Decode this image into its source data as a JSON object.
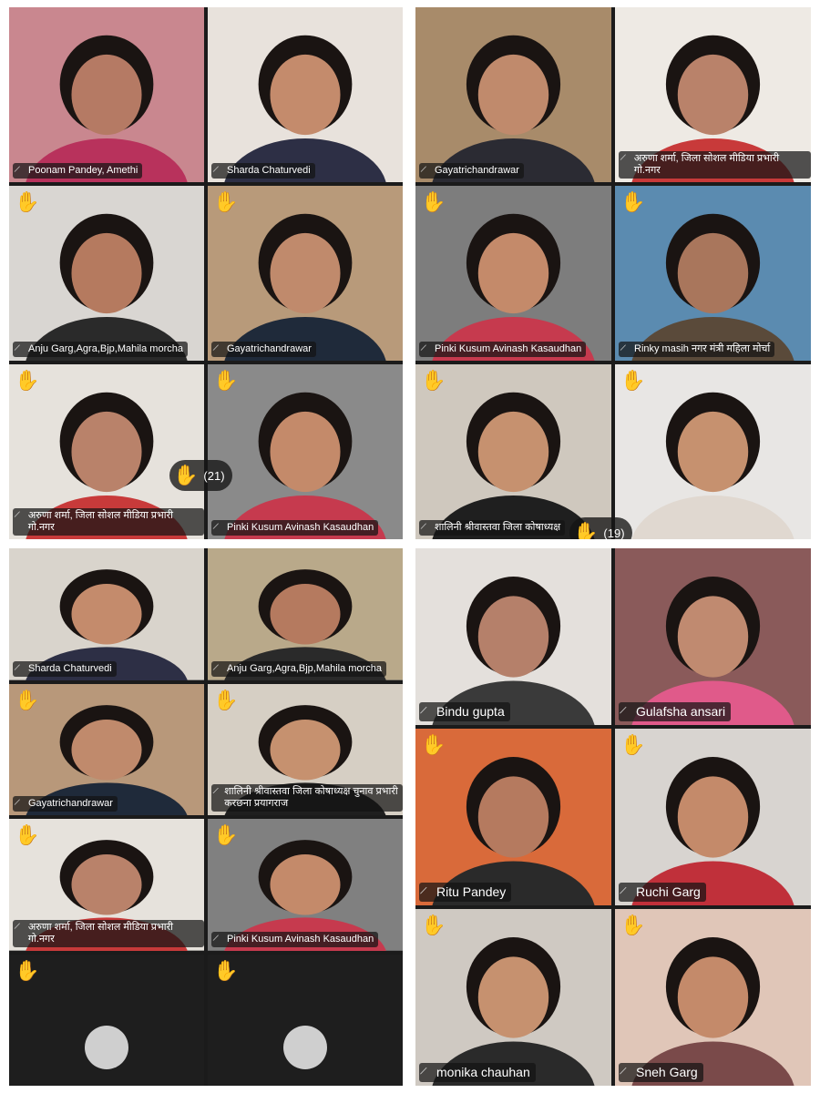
{
  "panels": [
    {
      "id": "panel-1",
      "raised_hand_count": "(21)",
      "tiles": [
        {
          "name": "Poonam Pandey, Amethi",
          "raised_hand": false,
          "bg": "#c9878f",
          "skin": "#b57a64",
          "cloth": "#b8325c"
        },
        {
          "name": "Sharda Chaturvedi",
          "raised_hand": false,
          "bg": "#e8e2dc",
          "skin": "#c48b6c",
          "cloth": "#2d2f45"
        },
        {
          "name": "Anju Garg,Agra,Bjp,Mahila morcha",
          "raised_hand": true,
          "bg": "#d9d6d2",
          "skin": "#b57a5f",
          "cloth": "#2a2a2a"
        },
        {
          "name": "Gayatrichandrawar",
          "raised_hand": true,
          "bg": "#b89a7a",
          "skin": "#c08a6c",
          "cloth": "#1f2a3a"
        },
        {
          "name": "अरुणा शर्मा, जिला सोशल मीडिया प्रभारी गो.नगर",
          "raised_hand": true,
          "active": true,
          "bg": "#e6e2dc",
          "skin": "#b9826a",
          "cloth": "#c83a3a"
        },
        {
          "name": "Pinki Kusum Avinash Kasaudhan",
          "raised_hand": true,
          "bg": "#8a8a8a",
          "skin": "#c48a6a",
          "cloth": "#c63a4e"
        }
      ]
    },
    {
      "id": "panel-2",
      "raised_hand_count": "(19)",
      "tiles": [
        {
          "name": "Gayatrichandrawar",
          "raised_hand": false,
          "bg": "#a88b6a",
          "skin": "#c08a6c",
          "cloth": "#2b2b33"
        },
        {
          "name": "अरुणा शर्मा, जिला सोशल मीडिया प्रभारी गो.नगर",
          "raised_hand": false,
          "bg": "#eeeae4",
          "skin": "#b9826a",
          "cloth": "#c83a3a"
        },
        {
          "name": "Pinki Kusum Avinash Kasaudhan",
          "raised_hand": true,
          "bg": "#7d7d7d",
          "skin": "#c48a6a",
          "cloth": "#c63a4e"
        },
        {
          "name": "Rinky masih नगर मंत्री महिला मोर्चा",
          "raised_hand": true,
          "bg": "#5b8bb0",
          "skin": "#a9765c",
          "cloth": "#5a4a3a"
        },
        {
          "name": "शालिनी श्रीवास्तवा जिला कोषाध्यक्ष",
          "raised_hand": true,
          "bg": "#cfc8be",
          "skin": "#c6916f",
          "cloth": "#1f1f1f"
        },
        {
          "name": "",
          "raised_hand": true,
          "bg": "#e8e6e4",
          "skin": "#c6916f",
          "cloth": "#e0d8d0"
        }
      ]
    },
    {
      "id": "panel-3",
      "tiles": [
        {
          "name": "Sharda Chaturvedi",
          "raised_hand": false,
          "bg": "#d9d4cc",
          "skin": "#c48b6c",
          "cloth": "#2d2f45"
        },
        {
          "name": "Anju Garg,Agra,Bjp,Mahila morcha",
          "raised_hand": false,
          "bg": "#b9a98a",
          "skin": "#b57a5f",
          "cloth": "#2a2a2a"
        },
        {
          "name": "Gayatrichandrawar",
          "raised_hand": true,
          "bg": "#b8987a",
          "skin": "#c08a6c",
          "cloth": "#1f2a3a"
        },
        {
          "name": "शालिनी श्रीवास्तवा जिला कोषाध्यक्ष चुनाव प्रभारी करछना प्रयागराज",
          "raised_hand": true,
          "bg": "#d6cfc4",
          "skin": "#c6916f",
          "cloth": "#1f1f1f"
        },
        {
          "name": "अरुणा शर्मा, जिला सोशल मीडिया प्रभारी गो.नगर",
          "raised_hand": true,
          "bg": "#e6e2dc",
          "skin": "#b9826a",
          "cloth": "#c83a3a"
        },
        {
          "name": "Pinki Kusum Avinash Kasaudhan",
          "raised_hand": true,
          "bg": "#808080",
          "skin": "#c48a6a",
          "cloth": "#c63a4e"
        },
        {
          "name": "",
          "raised_hand": true,
          "blank": true
        },
        {
          "name": "",
          "raised_hand": true,
          "blank": true
        }
      ]
    },
    {
      "id": "panel-4",
      "tiles": [
        {
          "name": "Bindu gupta",
          "raised_hand": false,
          "bg": "#e4e0dc",
          "skin": "#b5806a",
          "cloth": "#3a3a3a"
        },
        {
          "name": "Gulafsha ansari",
          "raised_hand": false,
          "bg": "#8a5a5a",
          "skin": "#c08a70",
          "cloth": "#e05a8a"
        },
        {
          "name": "Ritu Pandey",
          "raised_hand": true,
          "bg": "#d96a3a",
          "skin": "#b57a5f",
          "cloth": "#2a2a2a"
        },
        {
          "name": "Ruchi Garg",
          "raised_hand": true,
          "bg": "#d8d4d0",
          "skin": "#c48a6a",
          "cloth": "#c0303a"
        },
        {
          "name": "monika chauhan",
          "raised_hand": true,
          "bg": "#cfc9c2",
          "skin": "#c6916f",
          "cloth": "#2a2a2a"
        },
        {
          "name": "Sneh Garg",
          "raised_hand": true,
          "bg": "#e0c6b8",
          "skin": "#c48a6a",
          "cloth": "#7a4a4a"
        }
      ]
    }
  ]
}
